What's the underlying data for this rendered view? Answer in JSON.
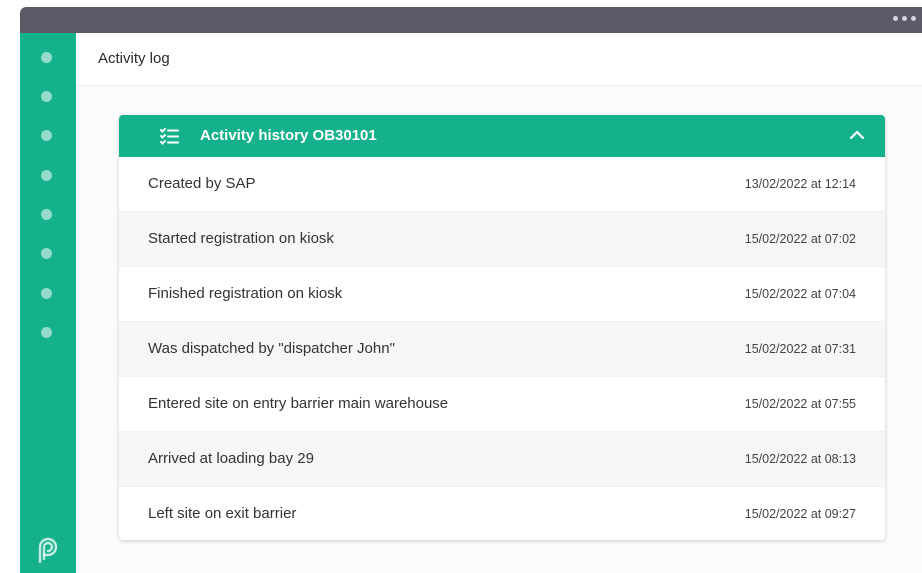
{
  "header": {
    "title": "Activity log"
  },
  "sidebar": {
    "items": [
      {
        "icon": "nav-dot-icon"
      },
      {
        "icon": "nav-dot-icon"
      },
      {
        "icon": "nav-dot-icon"
      },
      {
        "icon": "nav-dot-icon"
      },
      {
        "icon": "nav-dot-icon"
      },
      {
        "icon": "nav-dot-icon"
      },
      {
        "icon": "nav-dot-icon"
      },
      {
        "icon": "nav-dot-icon"
      }
    ],
    "logo_icon": "brand-logo-icon"
  },
  "panel": {
    "title": "Activity history OB30101",
    "icon": "list-icon",
    "collapse_icon": "chevron-up-icon",
    "rows": [
      {
        "text": "Created by SAP",
        "time": "13/02/2022 at 12:14"
      },
      {
        "text": "Started registration on kiosk",
        "time": "15/02/2022 at 07:02"
      },
      {
        "text": "Finished registration on kiosk",
        "time": "15/02/2022 at 07:04"
      },
      {
        "text": "Was dispatched by \"dispatcher John\"",
        "time": "15/02/2022 at 07:31"
      },
      {
        "text": "Entered site on entry barrier main warehouse",
        "time": "15/02/2022 at 07:55"
      },
      {
        "text": "Arrived at loading bay 29",
        "time": "15/02/2022 at 08:13"
      },
      {
        "text": "Left site on exit barrier",
        "time": "15/02/2022 at 09:27"
      }
    ]
  },
  "colors": {
    "accent": "#15b08c",
    "titlebar": "#5a5a68"
  }
}
